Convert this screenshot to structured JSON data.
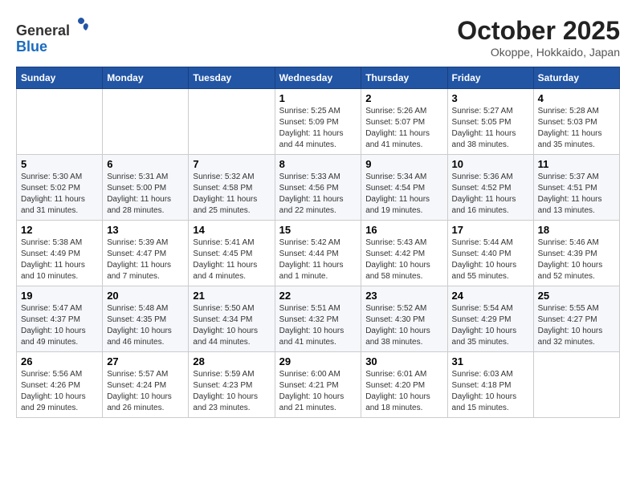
{
  "header": {
    "logo_line1": "General",
    "logo_line2": "Blue",
    "month_title": "October 2025",
    "location": "Okoppe, Hokkaido, Japan"
  },
  "weekdays": [
    "Sunday",
    "Monday",
    "Tuesday",
    "Wednesday",
    "Thursday",
    "Friday",
    "Saturday"
  ],
  "weeks": [
    [
      {
        "day": "",
        "info": ""
      },
      {
        "day": "",
        "info": ""
      },
      {
        "day": "",
        "info": ""
      },
      {
        "day": "1",
        "info": "Sunrise: 5:25 AM\nSunset: 5:09 PM\nDaylight: 11 hours and 44 minutes."
      },
      {
        "day": "2",
        "info": "Sunrise: 5:26 AM\nSunset: 5:07 PM\nDaylight: 11 hours and 41 minutes."
      },
      {
        "day": "3",
        "info": "Sunrise: 5:27 AM\nSunset: 5:05 PM\nDaylight: 11 hours and 38 minutes."
      },
      {
        "day": "4",
        "info": "Sunrise: 5:28 AM\nSunset: 5:03 PM\nDaylight: 11 hours and 35 minutes."
      }
    ],
    [
      {
        "day": "5",
        "info": "Sunrise: 5:30 AM\nSunset: 5:02 PM\nDaylight: 11 hours and 31 minutes."
      },
      {
        "day": "6",
        "info": "Sunrise: 5:31 AM\nSunset: 5:00 PM\nDaylight: 11 hours and 28 minutes."
      },
      {
        "day": "7",
        "info": "Sunrise: 5:32 AM\nSunset: 4:58 PM\nDaylight: 11 hours and 25 minutes."
      },
      {
        "day": "8",
        "info": "Sunrise: 5:33 AM\nSunset: 4:56 PM\nDaylight: 11 hours and 22 minutes."
      },
      {
        "day": "9",
        "info": "Sunrise: 5:34 AM\nSunset: 4:54 PM\nDaylight: 11 hours and 19 minutes."
      },
      {
        "day": "10",
        "info": "Sunrise: 5:36 AM\nSunset: 4:52 PM\nDaylight: 11 hours and 16 minutes."
      },
      {
        "day": "11",
        "info": "Sunrise: 5:37 AM\nSunset: 4:51 PM\nDaylight: 11 hours and 13 minutes."
      }
    ],
    [
      {
        "day": "12",
        "info": "Sunrise: 5:38 AM\nSunset: 4:49 PM\nDaylight: 11 hours and 10 minutes."
      },
      {
        "day": "13",
        "info": "Sunrise: 5:39 AM\nSunset: 4:47 PM\nDaylight: 11 hours and 7 minutes."
      },
      {
        "day": "14",
        "info": "Sunrise: 5:41 AM\nSunset: 4:45 PM\nDaylight: 11 hours and 4 minutes."
      },
      {
        "day": "15",
        "info": "Sunrise: 5:42 AM\nSunset: 4:44 PM\nDaylight: 11 hours and 1 minute."
      },
      {
        "day": "16",
        "info": "Sunrise: 5:43 AM\nSunset: 4:42 PM\nDaylight: 10 hours and 58 minutes."
      },
      {
        "day": "17",
        "info": "Sunrise: 5:44 AM\nSunset: 4:40 PM\nDaylight: 10 hours and 55 minutes."
      },
      {
        "day": "18",
        "info": "Sunrise: 5:46 AM\nSunset: 4:39 PM\nDaylight: 10 hours and 52 minutes."
      }
    ],
    [
      {
        "day": "19",
        "info": "Sunrise: 5:47 AM\nSunset: 4:37 PM\nDaylight: 10 hours and 49 minutes."
      },
      {
        "day": "20",
        "info": "Sunrise: 5:48 AM\nSunset: 4:35 PM\nDaylight: 10 hours and 46 minutes."
      },
      {
        "day": "21",
        "info": "Sunrise: 5:50 AM\nSunset: 4:34 PM\nDaylight: 10 hours and 44 minutes."
      },
      {
        "day": "22",
        "info": "Sunrise: 5:51 AM\nSunset: 4:32 PM\nDaylight: 10 hours and 41 minutes."
      },
      {
        "day": "23",
        "info": "Sunrise: 5:52 AM\nSunset: 4:30 PM\nDaylight: 10 hours and 38 minutes."
      },
      {
        "day": "24",
        "info": "Sunrise: 5:54 AM\nSunset: 4:29 PM\nDaylight: 10 hours and 35 minutes."
      },
      {
        "day": "25",
        "info": "Sunrise: 5:55 AM\nSunset: 4:27 PM\nDaylight: 10 hours and 32 minutes."
      }
    ],
    [
      {
        "day": "26",
        "info": "Sunrise: 5:56 AM\nSunset: 4:26 PM\nDaylight: 10 hours and 29 minutes."
      },
      {
        "day": "27",
        "info": "Sunrise: 5:57 AM\nSunset: 4:24 PM\nDaylight: 10 hours and 26 minutes."
      },
      {
        "day": "28",
        "info": "Sunrise: 5:59 AM\nSunset: 4:23 PM\nDaylight: 10 hours and 23 minutes."
      },
      {
        "day": "29",
        "info": "Sunrise: 6:00 AM\nSunset: 4:21 PM\nDaylight: 10 hours and 21 minutes."
      },
      {
        "day": "30",
        "info": "Sunrise: 6:01 AM\nSunset: 4:20 PM\nDaylight: 10 hours and 18 minutes."
      },
      {
        "day": "31",
        "info": "Sunrise: 6:03 AM\nSunset: 4:18 PM\nDaylight: 10 hours and 15 minutes."
      },
      {
        "day": "",
        "info": ""
      }
    ]
  ]
}
